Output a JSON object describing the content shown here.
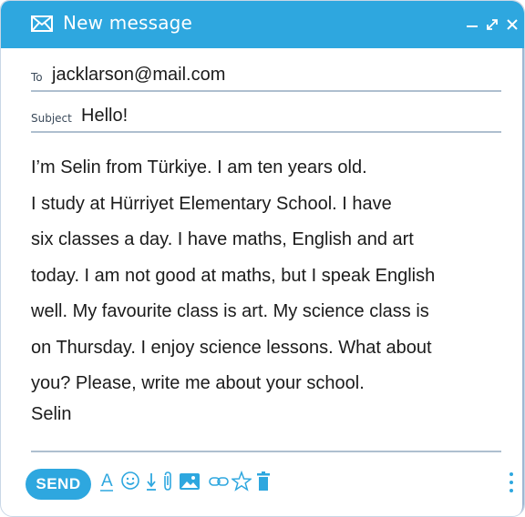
{
  "header": {
    "title": "New message",
    "icon": "mail-icon",
    "color": "#2ea7df"
  },
  "to": {
    "label": "To",
    "value": "jacklarson@mail.com"
  },
  "subject": {
    "label": "Subject",
    "value": "Hello!"
  },
  "body": {
    "lines": [
      "I’m Selin from Türkiye. I am ten years old.",
      "I study at Hürriyet Elementary School. I have",
      "six classes a day. I have maths, English and art",
      "today. I am not good at maths, but I speak English",
      "well. My favourite class is art. My science class is",
      "on Thursday. I enjoy science lessons. What about",
      "you? Please, write me about your school."
    ],
    "signature": "Selin"
  },
  "toolbar": {
    "send_label": "SEND",
    "format_label": "A",
    "tools": [
      "text-format-icon",
      "emoji-icon",
      "download-icon",
      "attachment-icon",
      "image-icon",
      "link-icon",
      "star-icon",
      "trash-icon",
      "more-options-icon"
    ]
  }
}
